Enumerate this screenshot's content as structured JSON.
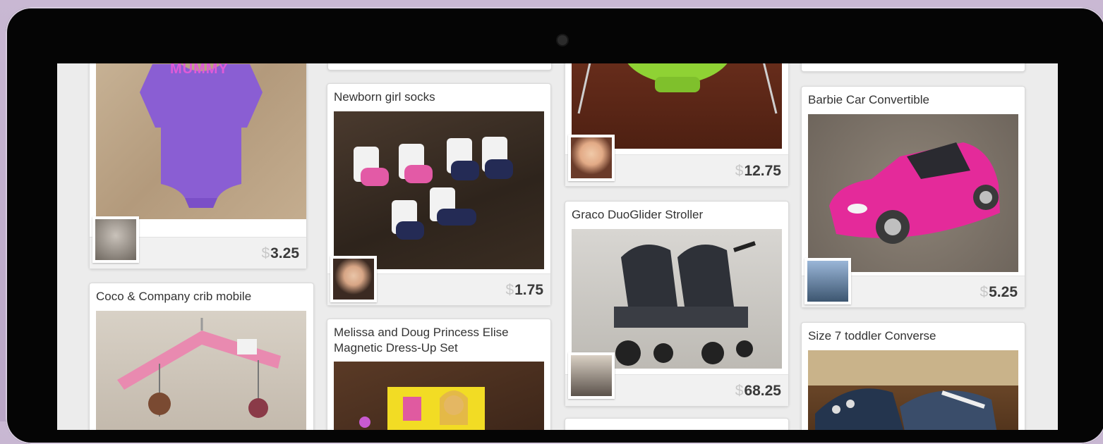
{
  "device": {
    "frame_color": "#050505",
    "background": "#c4b3d0"
  },
  "listings": [
    {
      "id": "onesie",
      "title": "",
      "price": "3.25",
      "currency": "$",
      "shirt_text": "MUMMY",
      "photo_icon": "purple-onesie-photo"
    },
    {
      "id": "socks",
      "title": "Newborn girl socks",
      "price": "1.75",
      "currency": "$",
      "photo_icon": "baby-socks-photo"
    },
    {
      "id": "bouncer",
      "title": "",
      "price": "12.75",
      "currency": "$",
      "photo_icon": "baby-bouncer-photo"
    },
    {
      "id": "barbie-car",
      "title": "Barbie Car Convertible",
      "price": "5.25",
      "currency": "$",
      "photo_icon": "pink-car-photo"
    },
    {
      "id": "crib-mobile",
      "title": "Coco & Company crib mobile",
      "photo_icon": "crib-mobile-photo"
    },
    {
      "id": "dress-up",
      "title": "Melissa and Doug Princess Elise Magnetic Dress-Up Set",
      "photo_icon": "dress-up-set-photo"
    },
    {
      "id": "stroller",
      "title": "Graco DuoGlider Stroller",
      "price": "68.25",
      "currency": "$",
      "photo_icon": "double-stroller-photo"
    },
    {
      "id": "converse",
      "title": "Size 7 toddler Converse",
      "photo_icon": "toddler-shoes-photo"
    }
  ]
}
